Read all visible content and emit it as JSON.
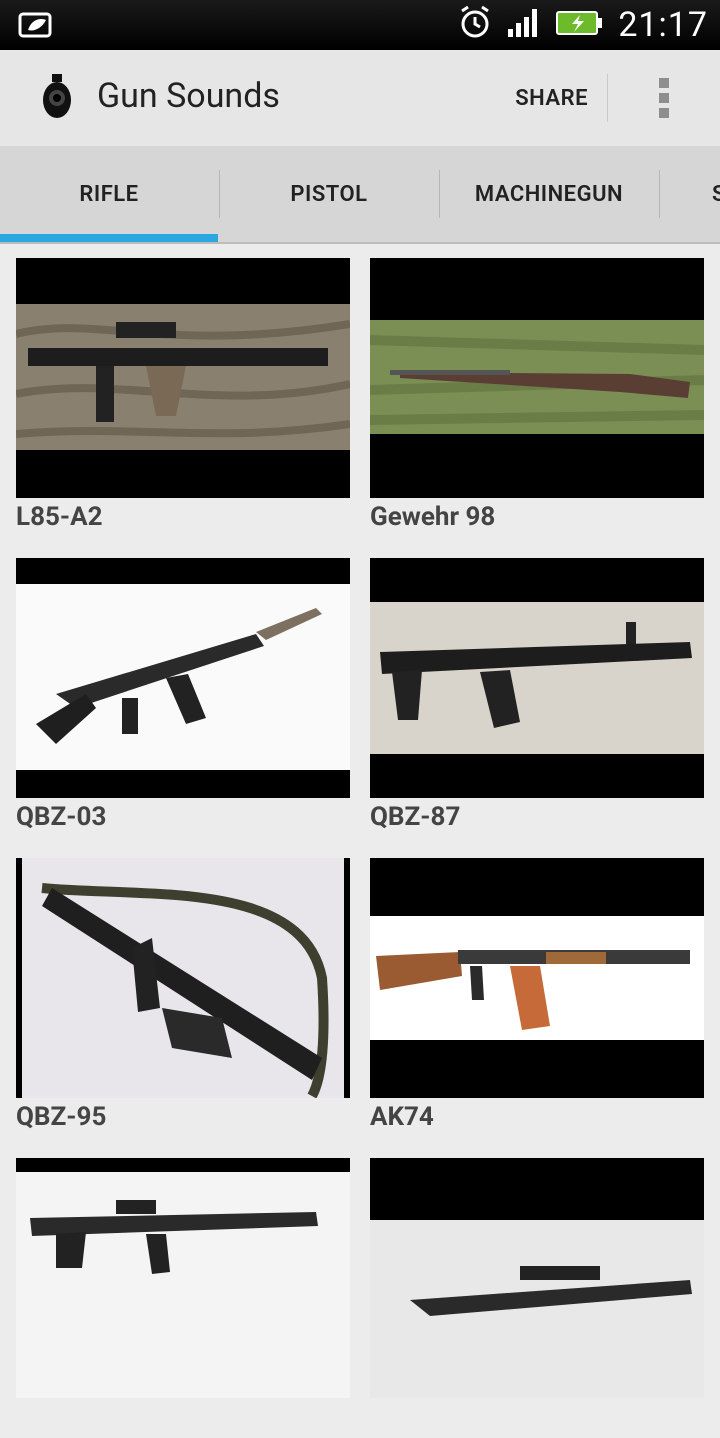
{
  "status_bar": {
    "time": "21:17",
    "icons": [
      "leaf-icon",
      "alarm-icon",
      "signal-icon",
      "battery-charging-icon"
    ]
  },
  "app_bar": {
    "title": "Gun Sounds",
    "share_label": "SHARE",
    "menu_icon": "overflow-menu-icon"
  },
  "tabs": [
    {
      "label": "RIFLE",
      "active": true
    },
    {
      "label": "PISTOL",
      "active": false
    },
    {
      "label": "MACHINEGUN",
      "active": false
    },
    {
      "label": "S",
      "active": false
    }
  ],
  "colors": {
    "accent": "#2aa7df",
    "bg": "#ececec"
  },
  "items": [
    {
      "name": "L85-A2"
    },
    {
      "name": "Gewehr 98"
    },
    {
      "name": "QBZ-03"
    },
    {
      "name": "QBZ-87"
    },
    {
      "name": "QBZ-95"
    },
    {
      "name": "AK74"
    },
    {
      "name": ""
    },
    {
      "name": ""
    }
  ]
}
